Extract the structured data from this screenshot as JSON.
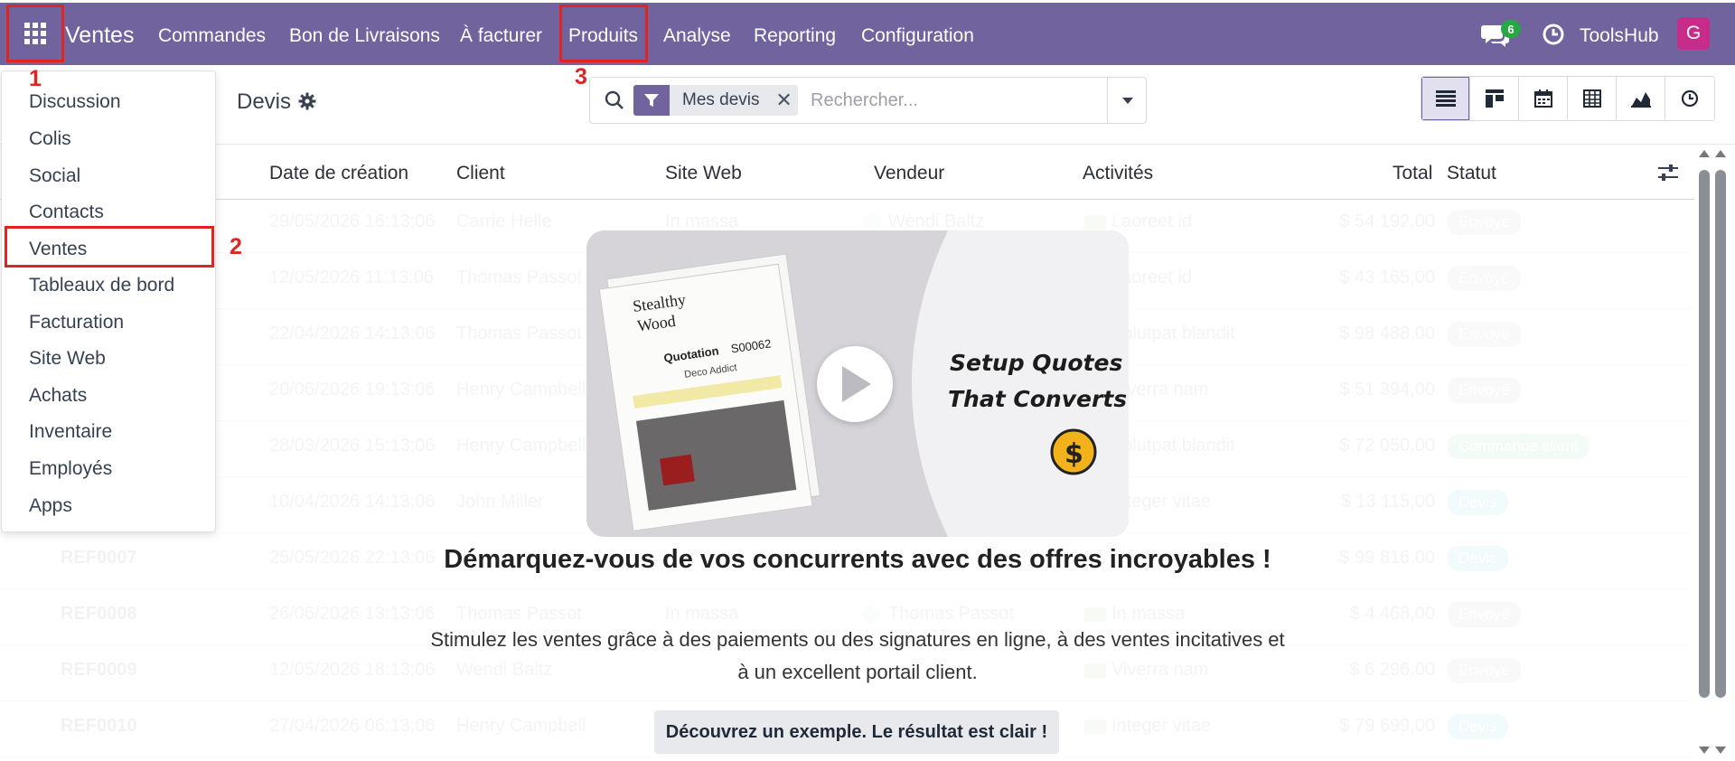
{
  "navbar": {
    "brand": "Ventes",
    "menus": [
      "Commandes",
      "Bon de Livraisons",
      "À facturer",
      "Produits",
      "Analyse",
      "Reporting",
      "Configuration"
    ],
    "chat_count": "6",
    "company": "ToolsHub",
    "avatar_letter": "G",
    "color": "#71639e"
  },
  "annotations": [
    "1",
    "2",
    "3"
  ],
  "apps_menu": [
    "Discussion",
    "Colis",
    "Social",
    "Contacts",
    "Ventes",
    "Tableaux de bord",
    "Facturation",
    "Site Web",
    "Achats",
    "Inventaire",
    "Employés",
    "Apps"
  ],
  "control": {
    "title": "Devis",
    "facet": "Mes devis",
    "search_placeholder": "Rechercher...",
    "views": [
      "list-icon",
      "kanban-icon",
      "calendar-icon",
      "pivot-icon",
      "graph-icon",
      "activity-icon"
    ]
  },
  "table": {
    "headers": {
      "date": "Date de création",
      "client": "Client",
      "site": "Site Web",
      "vendeur": "Vendeur",
      "activites": "Activités",
      "total": "Total",
      "statut": "Statut"
    },
    "rows": [
      {
        "ref": "",
        "date": "29/05/2026 16:13:06",
        "client": "Carrie Helle",
        "site": "In massa",
        "vendeur": "Wendi Baltz",
        "activite": "Laoreet id",
        "total": "$ 54 192,00",
        "statut": "Envoyé",
        "kind": "envoye"
      },
      {
        "ref": "",
        "date": "12/05/2026 11:13:06",
        "client": "Thomas Passot",
        "site": "",
        "vendeur": "",
        "activite": "Laoreet id",
        "total": "$ 43 165,00",
        "statut": "Envoyé",
        "kind": "envoye"
      },
      {
        "ref": "",
        "date": "22/04/2026 14:13:06",
        "client": "Thomas Passot",
        "site": "",
        "vendeur": "",
        "activite": "Volutpat blandit",
        "total": "$ 98 488,00",
        "statut": "Envoyé",
        "kind": "envoye"
      },
      {
        "ref": "",
        "date": "20/06/2026 19:13:06",
        "client": "Henry Campbell",
        "site": "",
        "vendeur": "",
        "activite": "Viverra nam",
        "total": "$ 51 394,00",
        "statut": "Envoyé",
        "kind": "envoye"
      },
      {
        "ref": "",
        "date": "28/03/2026 15:13:06",
        "client": "Henry Campbell",
        "site": "",
        "vendeur": "",
        "activite": "Volutpat blandit",
        "total": "$ 72 050,00",
        "statut": "Commande client",
        "kind": "commande"
      },
      {
        "ref": "",
        "date": "10/04/2026 14:13:06",
        "client": "John Miller",
        "site": "",
        "vendeur": "",
        "activite": "Integer vitae",
        "total": "$ 13 115,00",
        "statut": "Devis",
        "kind": "devis"
      },
      {
        "ref": "REF0007",
        "date": "25/05/2026 22:13:06",
        "client": "",
        "site": "",
        "vendeur": "",
        "activite": "",
        "total": "$ 99 816,00",
        "statut": "Devis",
        "kind": "devis"
      },
      {
        "ref": "REF0008",
        "date": "26/06/2026 13:13:06",
        "client": "Thomas Passot",
        "site": "In massa",
        "vendeur": "Thomas Passot",
        "activite": "In massa",
        "total": "$ 4 468,00",
        "statut": "Envoyé",
        "kind": "envoye"
      },
      {
        "ref": "REF0009",
        "date": "12/05/2026 18:13:06",
        "client": "Wendi Baltz",
        "site": "",
        "vendeur": "",
        "activite": "Viverra nam",
        "total": "$ 6 296,00",
        "statut": "Envoyé",
        "kind": "envoye"
      },
      {
        "ref": "REF0010",
        "date": "27/04/2026 06:13:06",
        "client": "Henry Campbell",
        "site": "",
        "vendeur": "",
        "activite": "Integer vitae",
        "total": "$ 79 699,00",
        "statut": "Devis",
        "kind": "devis"
      }
    ]
  },
  "help": {
    "video_line1": "Setup Quotes",
    "video_line2": "That Converts",
    "doc_brand1": "Stealthy",
    "doc_brand2": "Wood",
    "doc_title": "Quotation",
    "doc_num": "S00062",
    "doc_sub": "Deco Addict",
    "title": "Démarquez-vous de vos concurrents avec des offres incroyables !",
    "text": "Stimulez les ventes grâce à des paiements ou des signatures en ligne, à des ventes incitatives et à un excellent portail client.",
    "button": "Découvrez un exemple. Le résultat est clair !"
  }
}
